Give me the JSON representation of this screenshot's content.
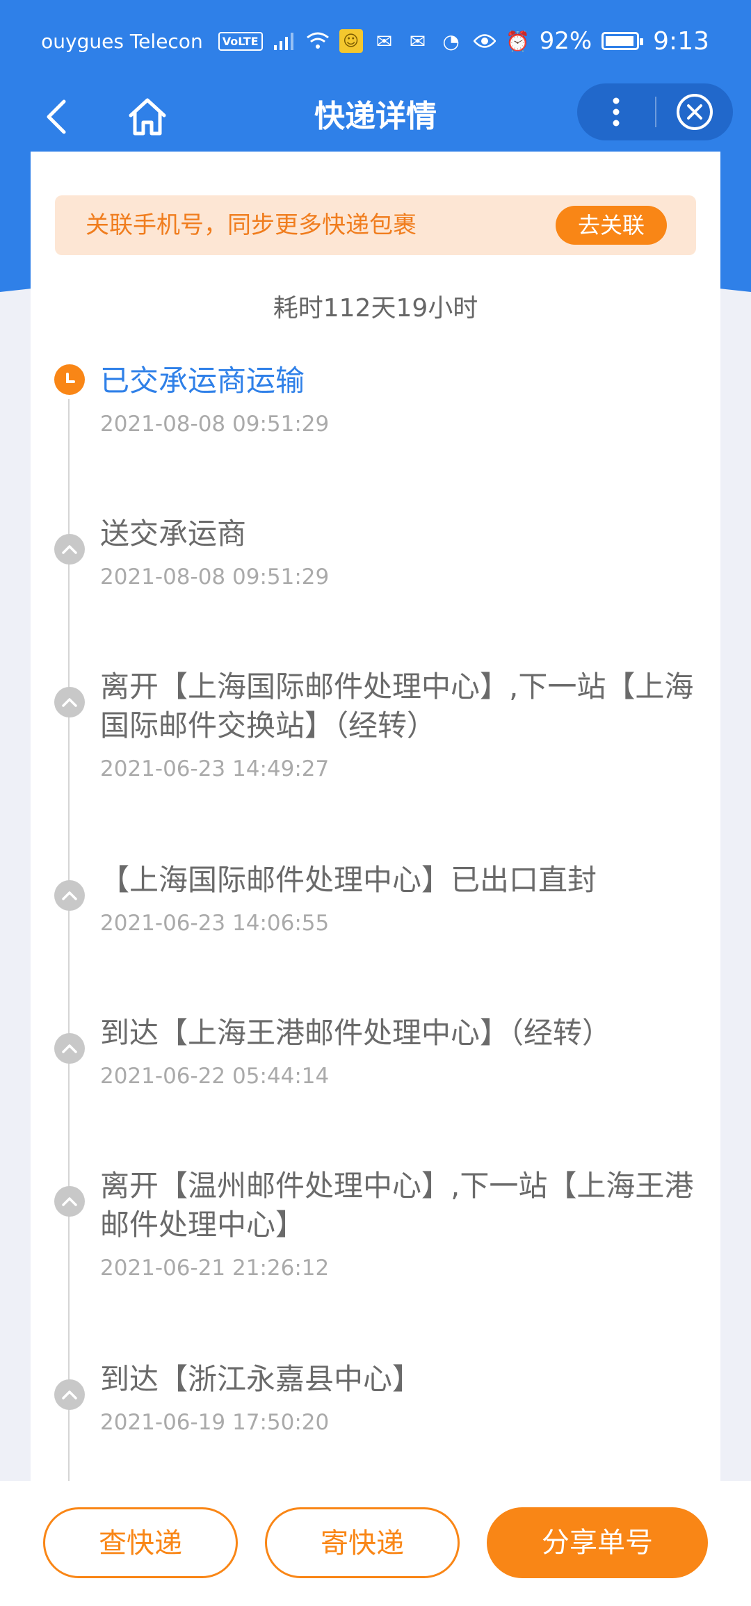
{
  "status_bar": {
    "carrier": "ouygues Telecon",
    "volte": "VoLTE",
    "battery": "92%",
    "time": "9:13"
  },
  "nav": {
    "title": "快递详情"
  },
  "banner": {
    "text": "关联手机号，同步更多快递包裹",
    "button": "去关联"
  },
  "duration": "耗时112天19小时",
  "events": [
    {
      "title": "已交承运商运输",
      "time": "2021-08-08 09:51:29",
      "active": true
    },
    {
      "title": "送交承运商",
      "time": "2021-08-08 09:51:29"
    },
    {
      "title": "离开【上海国际邮件处理中心】,下一站【上海国际邮件交换站】（经转）",
      "time": "2021-06-23 14:49:27"
    },
    {
      "title": "【上海国际邮件处理中心】已出口直封",
      "time": "2021-06-23 14:06:55"
    },
    {
      "title": "到达【上海王港邮件处理中心】（经转）",
      "time": "2021-06-22 05:44:14"
    },
    {
      "title": "离开【温州邮件处理中心】,下一站【上海王港邮件处理中心】",
      "time": "2021-06-21 21:26:12"
    },
    {
      "title": "到达【浙江永嘉县中心】",
      "time": "2021-06-19 17:50:20"
    }
  ],
  "bottom": {
    "check": "查快递",
    "send": "寄快递",
    "share": "分享单号"
  },
  "colors": {
    "primary_blue": "#2f80e8",
    "accent_orange": "#f98616"
  }
}
